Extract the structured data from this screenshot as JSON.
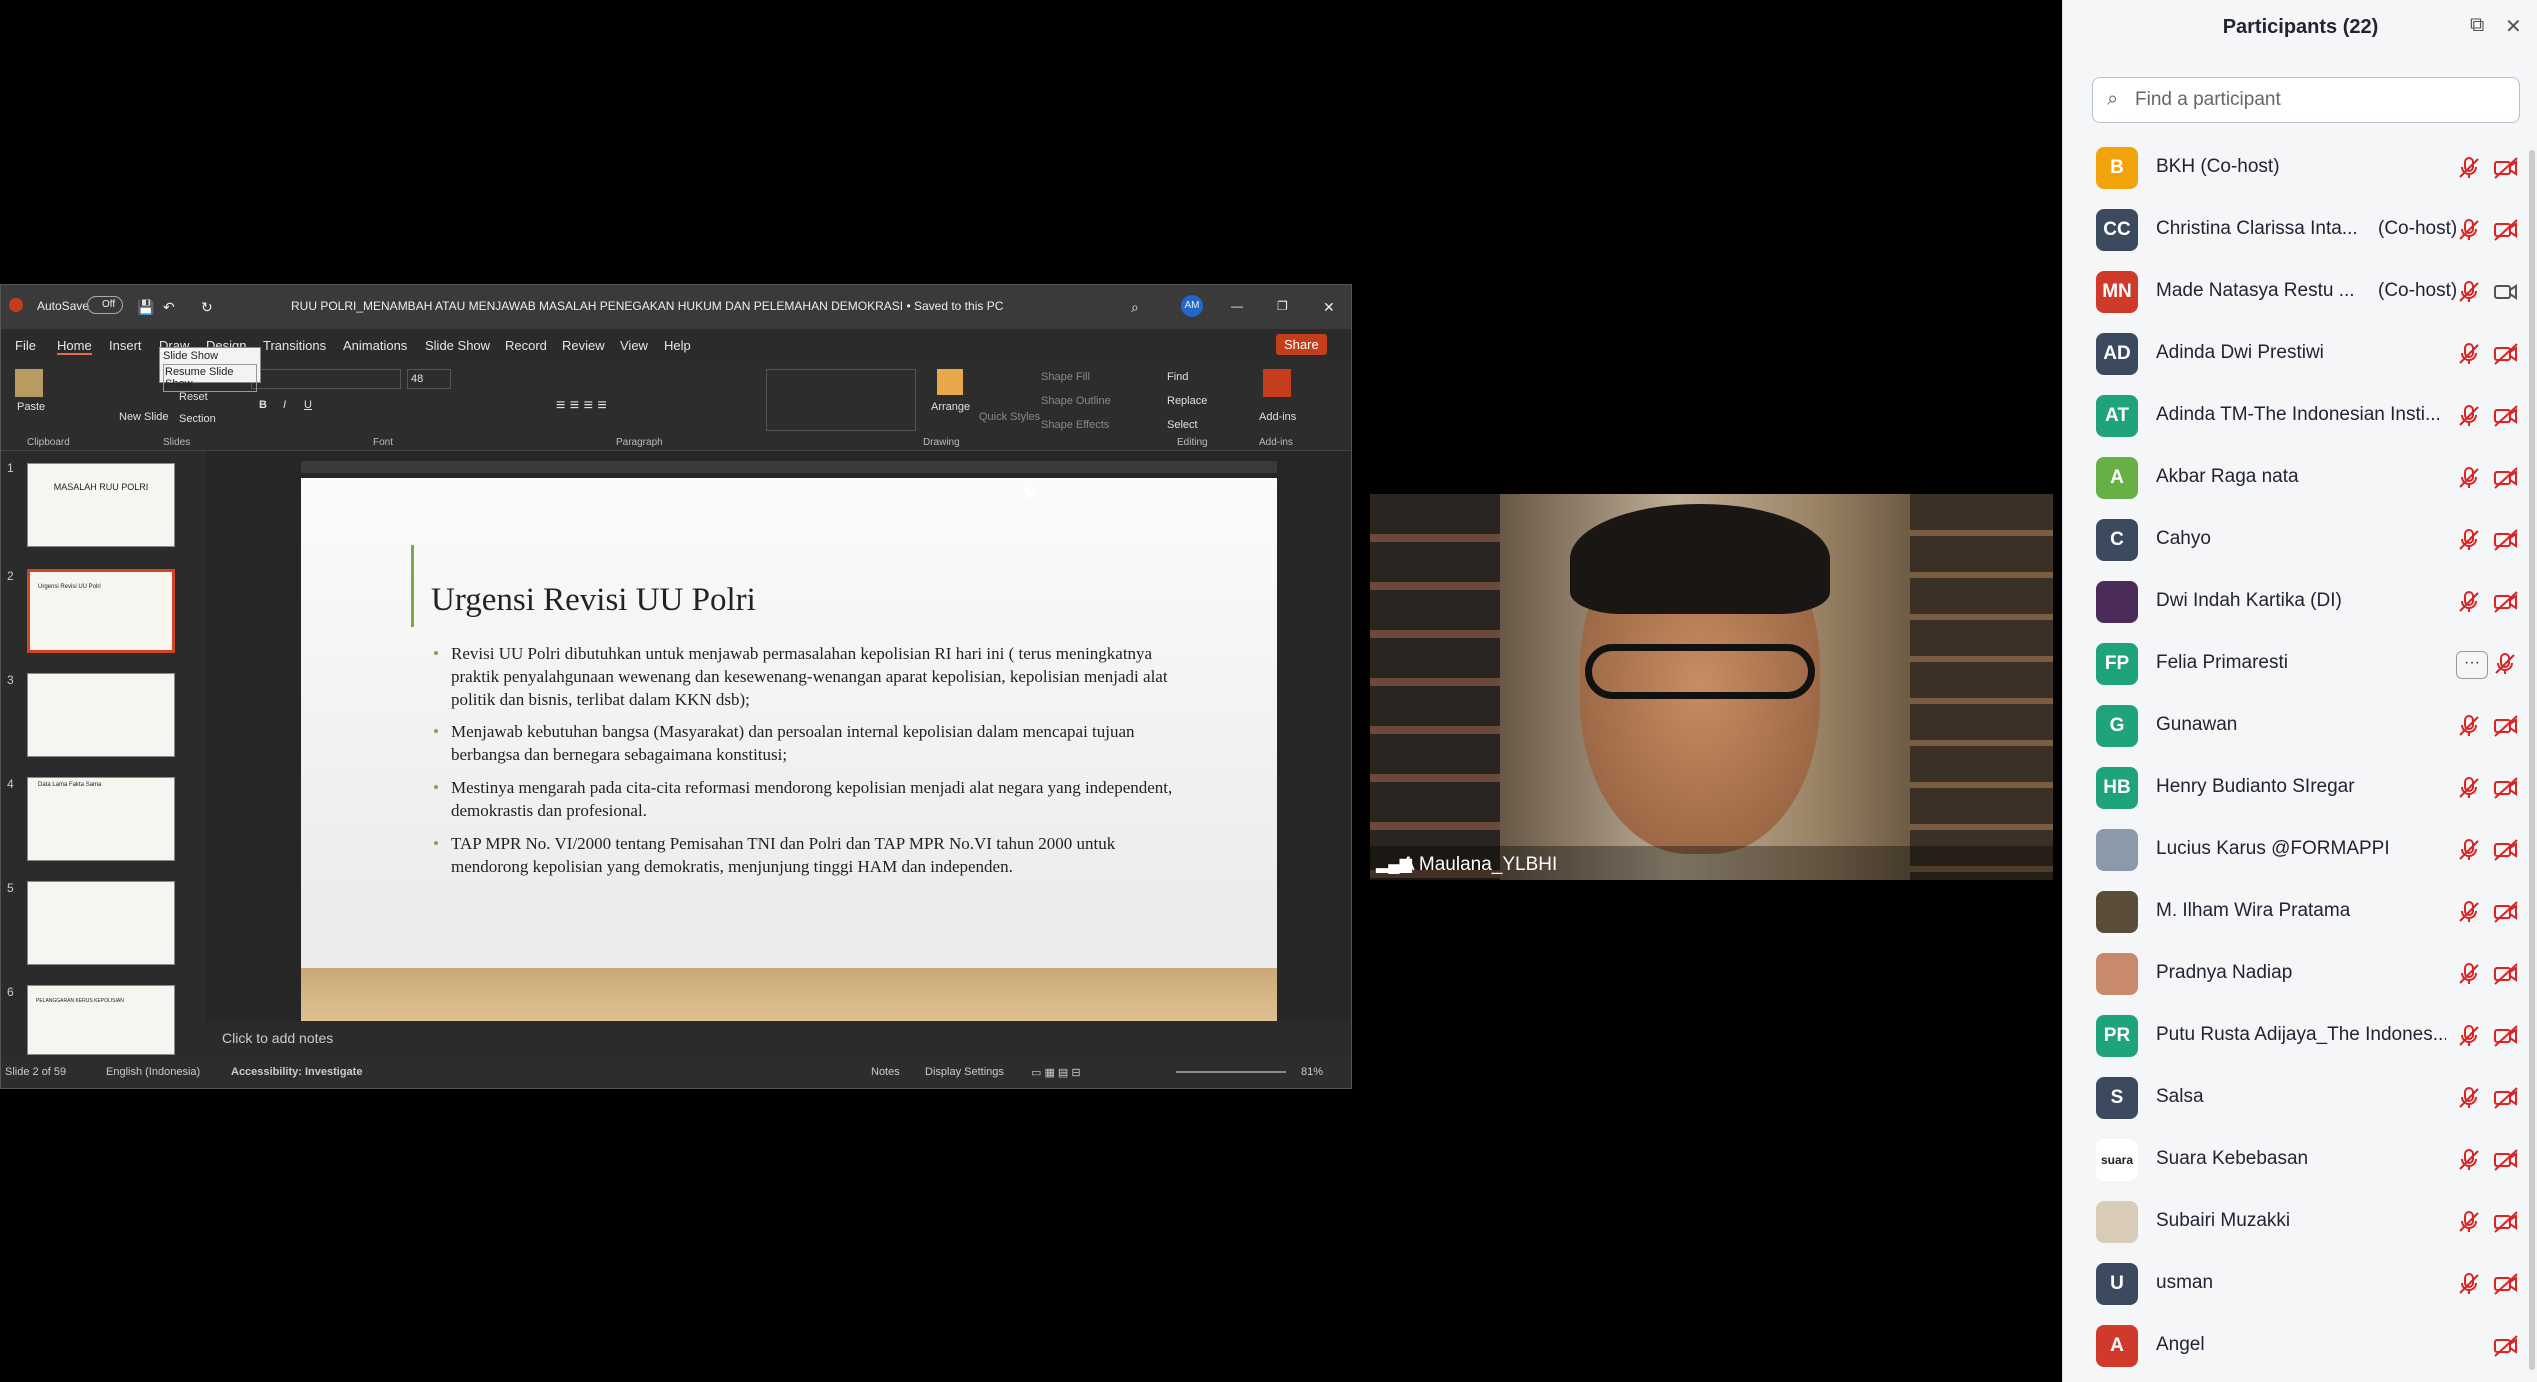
{
  "ppt": {
    "autosave": "AutoSave",
    "autosave_state": "Off",
    "title": "RUU POLRI_MENAMBAH ATAU MENJAWAB MASALAH PENEGAKAN HUKUM DAN PELEMAHAN DEMOKRASI • Saved to this PC",
    "user_initials": "AM",
    "menu": [
      "File",
      "Home",
      "Insert",
      "Draw",
      "Design",
      "Transitions",
      "Animations",
      "Slide Show",
      "Record",
      "Review",
      "View",
      "Help"
    ],
    "share": "Share",
    "tooltip_title": "Slide Show",
    "tooltip_item": "Resume Slide Show",
    "ribbon": {
      "paste": "Paste",
      "new_slide": "New Slide",
      "reset": "Reset",
      "section": "Section",
      "font_size": "48",
      "arrange": "Arrange",
      "quick_styles": "Quick Styles",
      "shape_fill": "Shape Fill",
      "shape_outline": "Shape Outline",
      "shape_effects": "Shape Effects",
      "find": "Find",
      "replace": "Replace",
      "select": "Select",
      "addins": "Add-ins",
      "groups": [
        "Clipboard",
        "Slides",
        "Font",
        "Paragraph",
        "Drawing",
        "Editing",
        "Add-ins"
      ]
    },
    "thumb_numbers": [
      "1",
      "2",
      "3",
      "4",
      "5",
      "6"
    ],
    "thumb_texts": [
      "MASALAH RUU POLRI",
      "Urgensi Revisi UU Polri",
      "",
      "Data Lama Fakta Sama",
      "",
      "PELANGGARAN KERUS KEPOLISIAN"
    ],
    "slide": {
      "title": "Urgensi Revisi UU Polri",
      "bullets": [
        "Revisi UU Polri dibutuhkan untuk menjawab permasalahan kepolisian RI hari ini ( terus meningkatnya praktik penyalahgunaan wewenang dan kesewenang-wenangan aparat kepolisian, kepolisian menjadi alat politik dan bisnis, terlibat dalam KKN dsb);",
        "Menjawab kebutuhan bangsa (Masyarakat) dan persoalan internal kepolisian dalam mencapai tujuan berbangsa dan bernegara sebagaimana konstitusi;",
        "Mestinya mengarah pada cita-cita reformasi mendorong kepolisian menjadi alat negara yang independent, demokrastis dan profesional.",
        "TAP MPR No. VI/2000  tentang Pemisahan TNI dan Polri dan TAP MPR No.VI tahun 2000 untuk mendorong kepolisian yang demokratis, menjunjung tinggi HAM dan independen."
      ]
    },
    "notes_placeholder": "Click to add notes",
    "status": {
      "slide_of": "Slide 2 of 59",
      "language": "English (Indonesia)",
      "accessibility": "Accessibility: Investigate",
      "notes": "Notes",
      "display_settings": "Display Settings",
      "zoom": "81%"
    }
  },
  "video": {
    "name": "A Maulana_YLBHI"
  },
  "participants": {
    "title": "Participants (22)",
    "search_placeholder": "Find a participant",
    "list": [
      {
        "initials": "B",
        "name": "BKH (Co-host)",
        "tag": "",
        "color": "#f0a30a",
        "mic": "muted",
        "cam": "off"
      },
      {
        "initials": "CC",
        "name": "Christina Clarissa Inta...",
        "tag": "(Co-host)",
        "color": "#3b4a5e",
        "mic": "muted",
        "cam": "off"
      },
      {
        "initials": "MN",
        "name": "Made Natasya Restu ...",
        "tag": "(Co-host)",
        "color": "#d03a2a",
        "mic": "muted",
        "cam": "on"
      },
      {
        "initials": "AD",
        "name": "Adinda Dwi Prestiwi",
        "tag": "",
        "color": "#3b4a5e",
        "mic": "muted",
        "cam": "off"
      },
      {
        "initials": "AT",
        "name": "Adinda TM-The Indonesian Insti...",
        "tag": "",
        "color": "#1fa37a",
        "mic": "muted",
        "cam": "off"
      },
      {
        "initials": "A",
        "name": "Akbar Raga nata",
        "tag": "",
        "color": "#66b045",
        "mic": "muted",
        "cam": "off"
      },
      {
        "initials": "C",
        "name": "Cahyo",
        "tag": "",
        "color": "#3b4a5e",
        "mic": "muted",
        "cam": "off"
      },
      {
        "initials": "",
        "name": "Dwi Indah Kartika (DI)",
        "tag": "",
        "color": "#4a2b5a",
        "mic": "muted",
        "cam": "off"
      },
      {
        "initials": "FP",
        "name": "Felia Primaresti",
        "tag": "",
        "color": "#1fa37a",
        "mic": "more",
        "cam": "muted"
      },
      {
        "initials": "G",
        "name": "Gunawan",
        "tag": "",
        "color": "#1fa37a",
        "mic": "muted",
        "cam": "off"
      },
      {
        "initials": "HB",
        "name": "Henry Budianto SIregar",
        "tag": "",
        "color": "#1fa37a",
        "mic": "muted",
        "cam": "off"
      },
      {
        "initials": "",
        "name": "Lucius Karus @FORMAPPI",
        "tag": "",
        "color": "#8a9aa8",
        "mic": "muted",
        "cam": "off"
      },
      {
        "initials": "",
        "name": "M. Ilham Wira Pratama",
        "tag": "",
        "color": "#5a4e3a",
        "mic": "muted",
        "cam": "off"
      },
      {
        "initials": "",
        "name": "Pradnya Nadiap",
        "tag": "",
        "color": "#c78a6a",
        "mic": "muted",
        "cam": "off"
      },
      {
        "initials": "PR",
        "name": "Putu Rusta Adijaya_The Indones...",
        "tag": "",
        "color": "#1fa37a",
        "mic": "muted",
        "cam": "off"
      },
      {
        "initials": "S",
        "name": "Salsa",
        "tag": "",
        "color": "#3b4a5e",
        "mic": "muted",
        "cam": "off"
      },
      {
        "initials": "suara",
        "name": "Suara Kebebasan",
        "tag": "",
        "color": "#ffffff",
        "mic": "muted",
        "cam": "off"
      },
      {
        "initials": "",
        "name": "Subairi Muzakki",
        "tag": "",
        "color": "#d8cbb8",
        "mic": "muted",
        "cam": "off"
      },
      {
        "initials": "U",
        "name": "usman",
        "tag": "",
        "color": "#3b4a5e",
        "mic": "muted",
        "cam": "off"
      },
      {
        "initials": "A",
        "name": "Angel",
        "tag": "",
        "color": "#d03a2a",
        "mic": "none",
        "cam": "off"
      }
    ]
  }
}
